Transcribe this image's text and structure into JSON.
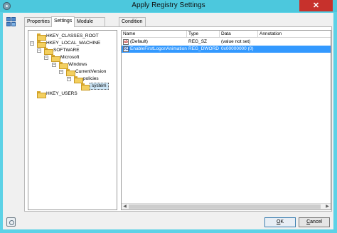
{
  "window": {
    "title": "Apply Registry Settings",
    "close_icon": "close-icon",
    "app_icon": "gear-icon"
  },
  "tabs": [
    {
      "label": "Properties",
      "active": false
    },
    {
      "label": "Settings",
      "active": true
    },
    {
      "label": "Module Parameters",
      "active": false
    },
    {
      "label": "Condition",
      "active": false
    }
  ],
  "tree": {
    "items": [
      {
        "label": "HKEY_CLASSES_ROOT",
        "expander": "+"
      },
      {
        "label": "HKEY_LOCAL_MACHINE",
        "expander": "−"
      },
      {
        "label": "SOFTWARE",
        "expander": "−"
      },
      {
        "label": "Microsoft",
        "expander": "−"
      },
      {
        "label": "Windows",
        "expander": "−"
      },
      {
        "label": "CurrentVersion",
        "expander": "−"
      },
      {
        "label": "policies",
        "expander": "−"
      },
      {
        "label": "system",
        "expander": ""
      },
      {
        "label": "HKEY_USERS",
        "expander": "+"
      }
    ]
  },
  "list": {
    "columns": [
      "Name",
      "Type",
      "Data",
      "Annotation"
    ],
    "rows": [
      {
        "icon_text": "ab",
        "name": "(Default)",
        "type": "REG_SZ",
        "data": "(value not set)",
        "annotation": ""
      },
      {
        "icon_text": "011",
        "name": "EnableFirstLogonAnimation",
        "type": "REG_DWORD",
        "data": "0x00000000 (0)",
        "annotation": ""
      }
    ],
    "selected_row": 1
  },
  "buttons": {
    "ok": "OK",
    "cancel": "Cancel",
    "ok_mnemonic": "O",
    "cancel_mnemonic": "C"
  },
  "colors": {
    "titlebar": "#4cc8dd",
    "close": "#c7312c",
    "selection": "#3399ff"
  }
}
